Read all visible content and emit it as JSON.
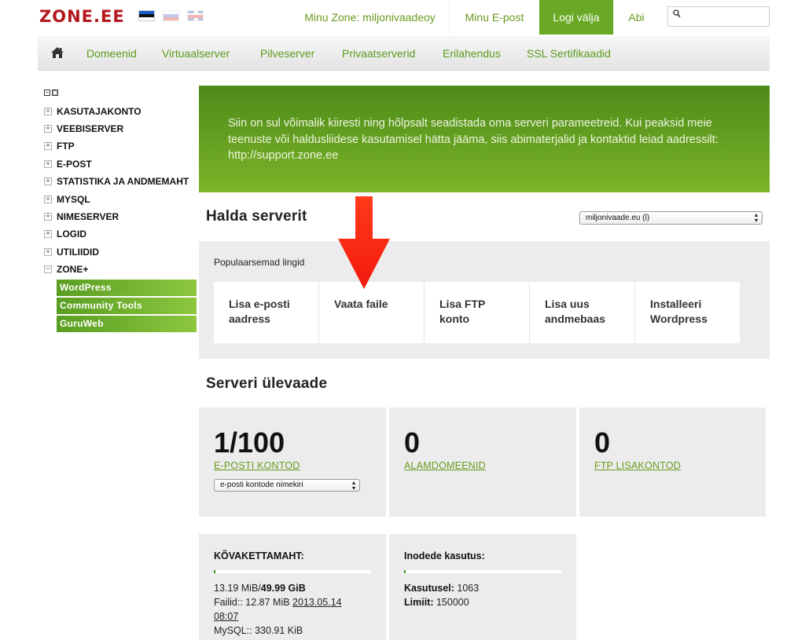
{
  "header": {
    "logo": "ZONE.EE",
    "flags": [
      "flag-estonia-icon",
      "flag-russia-icon",
      "flag-uk-icon"
    ],
    "nav": {
      "minu_zone": "Minu Zone: miljonivaadeoy",
      "minu_epost": "Minu E-post",
      "logi_valja": "Logi välja",
      "abi": "Abi"
    },
    "search": {
      "placeholder": ""
    }
  },
  "main_nav": {
    "home_icon": "home-icon",
    "items": [
      "Domeenid",
      "Virtuaalserver",
      "Pilveserver",
      "Privaatserverid",
      "Erilahendus",
      "SSL Sertifikaadid"
    ]
  },
  "sidebar": {
    "toggles": [
      "−",
      "□"
    ],
    "items": [
      {
        "label": "KASUTAJAKONTO",
        "sign": "+"
      },
      {
        "label": "VEEBISERVER",
        "sign": "+"
      },
      {
        "label": "FTP",
        "sign": "+"
      },
      {
        "label": "E-POST",
        "sign": "+"
      },
      {
        "label": "STATISTIKA JA ANDMEMAHT",
        "sign": "+"
      },
      {
        "label": "MYSQL",
        "sign": "+"
      },
      {
        "label": "NIMESERVER",
        "sign": "+"
      },
      {
        "label": "LOGID",
        "sign": "+"
      },
      {
        "label": "UTILIIDID",
        "sign": "+"
      },
      {
        "label": "ZONE+",
        "sign": "−"
      }
    ],
    "sub_items": [
      "WordPress",
      "Community Tools",
      "GuruWeb"
    ]
  },
  "banner": {
    "text": "Siin on sul võimalik kiiresti ning hõlpsalt seadistada oma serveri parameetreid. Kui peaksid meie teenuste või haldusliidese kasutamisel hätta jääma, siis abimaterjalid ja kontaktid leiad aadressilt: http://support.zone.ee"
  },
  "manage": {
    "title": "Halda serverit",
    "server_select": "miljonivaade.eu (l)",
    "popular_title": "Populaarsemad lingid",
    "links": [
      {
        "line1": "Lisa e-posti",
        "line2": "aadress"
      },
      {
        "line1": "Vaata faile",
        "line2": ""
      },
      {
        "line1": "Lisa FTP",
        "line2": "konto"
      },
      {
        "line1": "Lisa uus",
        "line2": "andmebaas"
      },
      {
        "line1": "Installeeri",
        "line2": "Wordpress"
      }
    ]
  },
  "overview": {
    "title": "Serveri ülevaade",
    "email": {
      "value": "1/100",
      "label": "E-POSTI KONTOD",
      "select": "e-posti kontode nimekiri"
    },
    "subdomains": {
      "value": "0",
      "label": "ALAMDOMEENID"
    },
    "ftp": {
      "value": "0",
      "label": "FTP LISAKONTOD"
    }
  },
  "disk": {
    "title": "KÕVAKETTAMAHT:",
    "used": "13.19 MiB/",
    "total": "49.99 GiB",
    "usage_fraction": 0.0003,
    "files_label": "Failid:: 12.87 MiB ",
    "files_date": "2013.05.14",
    "files_time": "08:07",
    "mysql": "MySQL:: 330.91 KiB"
  },
  "inodes": {
    "title": "Inodede kasutus:",
    "used_label": "Kasutusel:",
    "used_value": " 1063",
    "limit_label": "Limiit:",
    "limit_value": " 150000",
    "usage_fraction": 0.0071
  },
  "colors": {
    "brand_red": "#b5171f",
    "accent_green": "#6aa925",
    "arrow_red": "#ff2a12"
  }
}
